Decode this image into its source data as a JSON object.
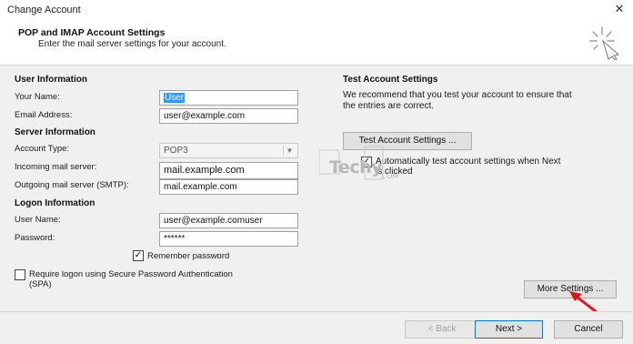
{
  "window": {
    "title": "Change Account",
    "close_glyph": "✕"
  },
  "header": {
    "title": "POP and IMAP Account Settings",
    "subtitle": "Enter the mail server settings for your account.",
    "icon": "sparkle-icon"
  },
  "user_info": {
    "heading": "User Information",
    "name_label": "Your Name:",
    "name_value": "User",
    "email_label": "Email Address:",
    "email_value": "user@example.com"
  },
  "server_info": {
    "heading": "Server Information",
    "account_type_label": "Account Type:",
    "account_type_value": "POP3",
    "incoming_label": "Incoming mail server:",
    "incoming_value": "mail.example.com",
    "outgoing_label": "Outgoing mail server (SMTP):",
    "outgoing_value": "mail.example.com"
  },
  "logon_info": {
    "heading": "Logon Information",
    "username_label": "User Name:",
    "username_value": "user@example.comuser",
    "password_label": "Password:",
    "password_value": "******",
    "remember_label": "Remember password",
    "remember_checked": true,
    "spa_label_line1": "Require logon using Secure Password Authentication",
    "spa_label_line2": "(SPA)",
    "spa_checked": false
  },
  "test_settings": {
    "heading": "Test Account Settings",
    "description_line1": "We recommend that you test your account to ensure that",
    "description_line2": "the entries are correct.",
    "test_button": "Test Account Settings ...",
    "auto_test_label_line1": "Automatically test account settings when Next",
    "auto_test_label_line2": "is clicked",
    "auto_test_checked": true
  },
  "more_settings_button": "More Settings ...",
  "footer": {
    "back_button": "< Back",
    "next_button": "Next >",
    "cancel_button": "Cancel"
  },
  "watermark": {
    "line1": "Techy",
    "line2": ".COM"
  },
  "colors": {
    "selection": "#3399ff",
    "primary_border": "#0078d7",
    "annotation_arrow": "#e0141e"
  }
}
